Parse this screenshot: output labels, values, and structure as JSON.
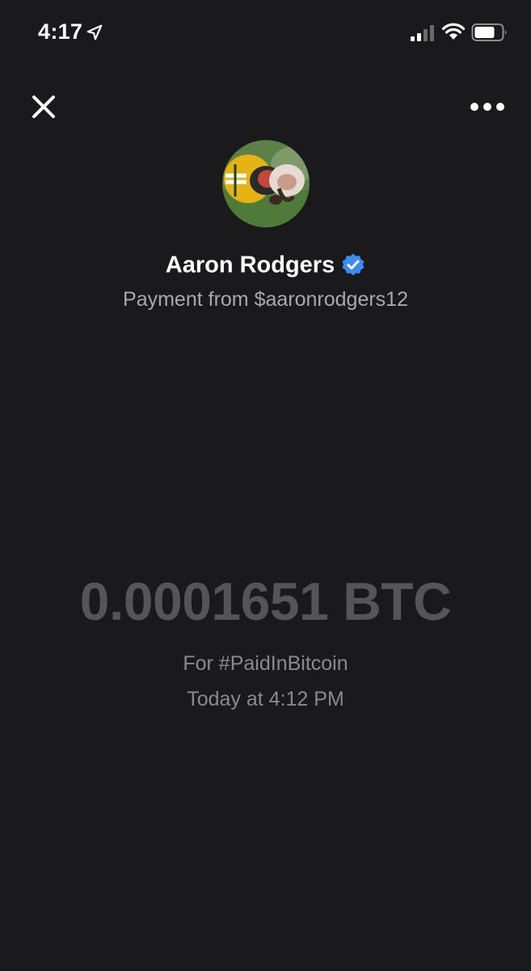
{
  "status_bar": {
    "time": "4:17",
    "icons": [
      "location-arrow-icon",
      "cellular-signal-icon",
      "wifi-icon",
      "battery-icon"
    ]
  },
  "nav": {
    "close_icon": "close-icon",
    "more_icon": "more-options-icon"
  },
  "sender": {
    "name": "Aaron Rodgers",
    "verified": true,
    "subtitle": "Payment from $aaronrodgers12"
  },
  "payment": {
    "amount": "0.0001651 BTC",
    "note": "For #PaidInBitcoin",
    "timestamp": "Today at 4:12 PM"
  },
  "colors": {
    "background": "#1a1a1c",
    "text_primary": "#ffffff",
    "text_secondary": "#a9a9ab",
    "amount": "#555557",
    "verified_badge": "#3d8bf2"
  }
}
